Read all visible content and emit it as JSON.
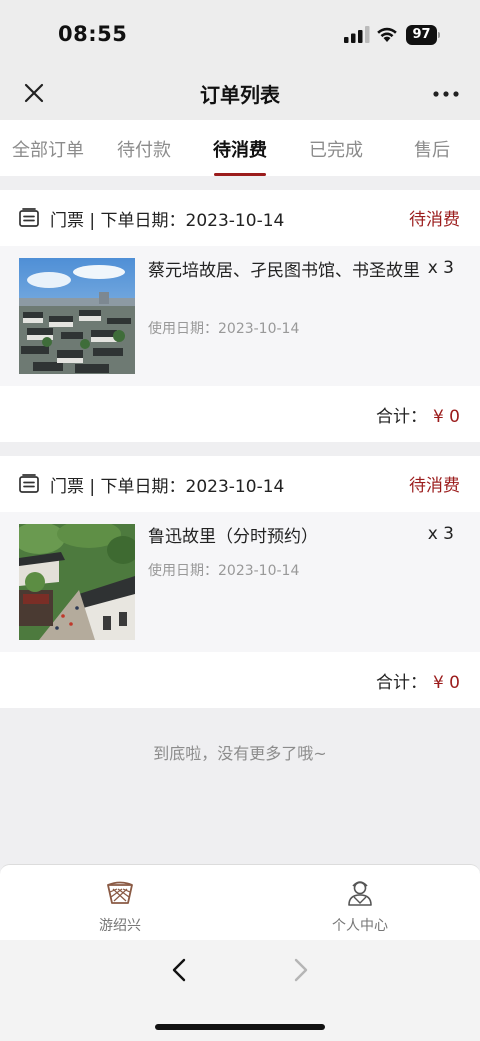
{
  "status_bar": {
    "time": "08:55",
    "battery": "97"
  },
  "nav": {
    "title": "订单列表"
  },
  "tabs": [
    {
      "label": "全部订单",
      "active": false
    },
    {
      "label": "待付款",
      "active": false
    },
    {
      "label": "待消费",
      "active": true
    },
    {
      "label": "已完成",
      "active": false
    },
    {
      "label": "售后",
      "active": false
    }
  ],
  "orders": [
    {
      "category_date": "门票 | 下单日期：2023-10-14",
      "status": "待消费",
      "item_name": "蔡元培故居、孑民图书馆、书圣故里",
      "quantity": "x 3",
      "use_date": "使用日期：2023-10-14",
      "total_label": "合计：",
      "total_price": "¥ 0"
    },
    {
      "category_date": "门票 | 下单日期：2023-10-14",
      "status": "待消费",
      "item_name": "鲁迅故里（分时预约）",
      "quantity": "x 3",
      "use_date": "使用日期：2023-10-14",
      "total_label": "合计：",
      "total_price": "¥ 0"
    }
  ],
  "end_message": "到底啦，没有更多了哦~",
  "bottom_nav": [
    {
      "label": "游绍兴",
      "icon": "basket-icon"
    },
    {
      "label": "个人中心",
      "icon": "person-icon"
    }
  ],
  "colors": {
    "accent": "#9b1c1c",
    "background": "#efeff1"
  }
}
